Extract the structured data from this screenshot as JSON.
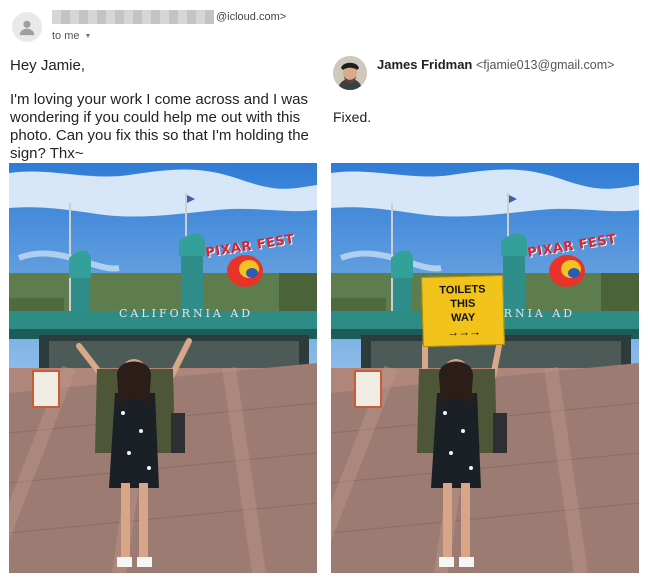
{
  "email": {
    "sender_domain": "@icloud.com>",
    "to_label": "to me",
    "greeting": "Hey Jamie,",
    "body": "I'm loving your work I come across and I was wondering if you could help me out with this photo. Can you fix this so that I'm holding the sign? Thx~"
  },
  "reply": {
    "name": "James Fridman",
    "email": "<fjamie013@gmail.com>",
    "body": "Fixed."
  },
  "scene": {
    "building_sign": "PIXAR FEST",
    "building_band": "CALIFORNIA AD"
  },
  "held_sign": {
    "line1": "TOILETS",
    "line2": "THIS",
    "line3": "WAY",
    "arrows": "→→→"
  },
  "icons": {
    "sender_avatar": "person-icon",
    "to_dropdown": "chevron-down-icon"
  }
}
